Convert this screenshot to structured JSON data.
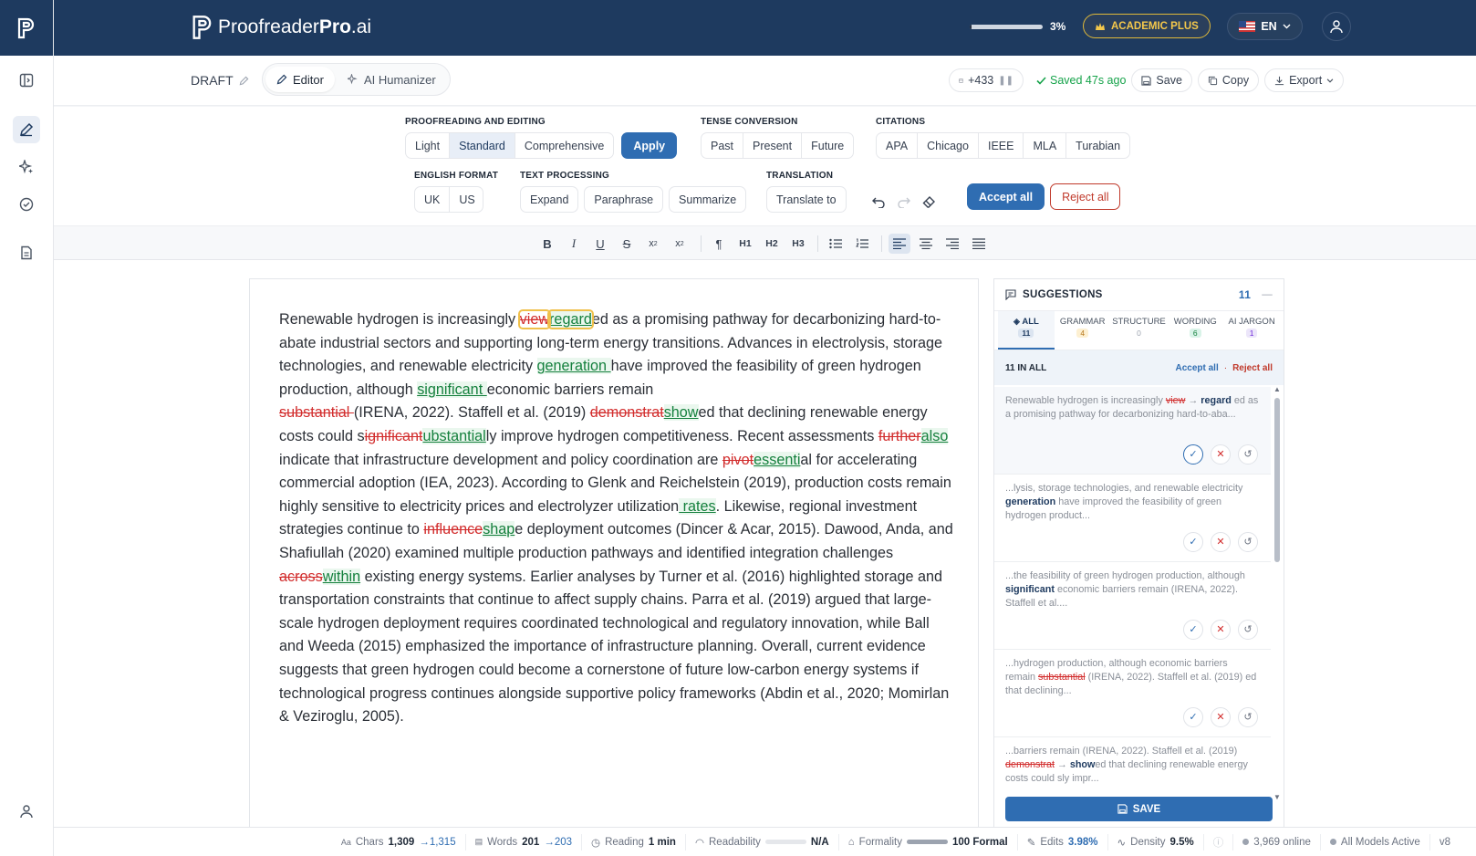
{
  "brand": {
    "name_light": "Proofreader",
    "name_bold": "Pro",
    "name_suffix": ".ai"
  },
  "header": {
    "progress_label": "3%",
    "progress_value": 0.03,
    "plan": "ACADEMIC PLUS",
    "language": "EN"
  },
  "subheader": {
    "draft": "DRAFT",
    "tabs": [
      {
        "label": "Editor"
      },
      {
        "label": "AI Humanizer"
      }
    ],
    "counter": "+433",
    "saved": "Saved 47s ago",
    "save": "Save",
    "copy": "Copy",
    "export": "Export"
  },
  "tools": {
    "proofreading": {
      "label": "PROOFREADING AND EDITING",
      "options": [
        "Light",
        "Standard",
        "Comprehensive"
      ],
      "selected": "Standard",
      "apply": "Apply"
    },
    "tense": {
      "label": "TENSE CONVERSION",
      "options": [
        "Past",
        "Present",
        "Future"
      ]
    },
    "citations": {
      "label": "CITATIONS",
      "options": [
        "APA",
        "Chicago",
        "IEEE",
        "MLA",
        "Turabian"
      ]
    },
    "english": {
      "label": "ENGLISH FORMAT",
      "options": [
        "UK",
        "US"
      ]
    },
    "text_processing": {
      "label": "TEXT PROCESSING",
      "options": [
        "Expand",
        "Paraphrase",
        "Summarize"
      ]
    },
    "translation": {
      "label": "TRANSLATION",
      "button": "Translate to"
    },
    "accept_all": "Accept all",
    "reject_all": "Reject all"
  },
  "format": {
    "h1": "H1",
    "h2": "H2",
    "h3": "H3"
  },
  "document": {
    "t01": "Renewable hydrogen is increasingly ",
    "d01": "view",
    "i01": "regard",
    "t02": "ed as a promising pathway for decarbonizing hard-to-abate industrial sectors and supporting long-term energy transitions. Advances in electrolysis, storage technologies, and renewable electricity ",
    "i02": "generation ",
    "t03": "have improved the feasibility of green hydrogen production, although ",
    "i03": "significant ",
    "t04": "economic barriers remain ",
    "d04": "substantial ",
    "t05": "(IRENA, 2022). Staffell et al. (2019) ",
    "d05": "demonstrat",
    "i05": "show",
    "t06": "ed that declining renewable energy costs could s",
    "d06": "ignificant",
    "i06": "ubstantial",
    "t07": "ly improve hydrogen competitiveness. Recent assessments ",
    "d07": "further",
    "i07": "also",
    "t08": " indicate that infrastructure development and policy coordination are ",
    "d08": "pivot",
    "i08": "essenti",
    "t09": "al for accelerating commercial adoption (IEA, 2023). According to Glenk and Reichelstein (2019), production costs remain highly sensitive to electricity prices and electrolyzer utilization",
    "i09": " rates",
    "t10": ". Likewise, regional investment strategies continue to ",
    "d10": "influence",
    "i10": "shap",
    "t11": "e deployment outcomes (Dincer & Acar, 2015). Dawood, Anda, and Shafiullah (2020) examined multiple production pathways and identified integration challenges ",
    "d11": "across",
    "i11": "within",
    "t12": " existing energy systems. Earlier analyses by Turner et al. (2016) highlighted storage and transportation constraints that continue to affect supply chains. Parra et al. (2019) argued that large-scale hydrogen deployment requires coordinated technological and regulatory innovation, while Ball and Weeda (2015) emphasized the importance of infrastructure planning. Overall, current evidence suggests that green hydrogen could become a cornerstone of future low-carbon energy systems if technological progress continues alongside supportive policy frameworks (Abdin et al., 2020; Momirlan & Veziroglu, 2005)."
  },
  "panel": {
    "title": "SUGGESTIONS",
    "count": "11",
    "tabs": [
      {
        "label": "ALL",
        "n": "11"
      },
      {
        "label": "GRAMMAR",
        "n": "4"
      },
      {
        "label": "STRUCTURE",
        "n": "0"
      },
      {
        "label": "WORDING",
        "n": "6"
      },
      {
        "label": "AI JARGON",
        "n": "1"
      }
    ],
    "summary": "11 IN ALL",
    "accept_all": "Accept all",
    "reject_all": "Reject all",
    "items": [
      {
        "pre": "Renewable hydrogen is increasingly ",
        "del": "view",
        "arrow": "→",
        "ins": "regard",
        "post": "ed as a promising pathway for decarbonizing hard-to-aba..."
      },
      {
        "pre": "...lysis, storage technologies, and renewable electricity ",
        "ins": "generation",
        "post": " have improved the feasibility of green hydrogen product..."
      },
      {
        "pre": "...the feasibility of green hydrogen production, although ",
        "ins": "significant",
        "post": " economic barriers remain (IRENA, 2022). Staffell et al...."
      },
      {
        "pre": "...hydrogen production, although economic barriers remain ",
        "del": "substantial",
        "post": " (IRENA, 2022). Staffell et al. (2019) ed that declining..."
      },
      {
        "pre": "...barriers remain (IRENA, 2022). Staffell et al. (2019) ",
        "del": "demonstrat",
        "arrow": "→",
        "ins": "show",
        "post": "ed that declining renewable energy costs could sly impr..."
      }
    ],
    "save": "SAVE"
  },
  "status": {
    "chars_label": "Chars",
    "chars_from": "1,309",
    "chars_to": "→1,315",
    "words_label": "Words",
    "words_from": "201",
    "words_to": "→203",
    "reading_label": "Reading",
    "reading_value": "1 min",
    "readability_label": "Readability",
    "readability_value": "N/A",
    "formality_label": "Formality",
    "formality_value": "100 Formal",
    "formality_level": 1.0,
    "edits_label": "Edits",
    "edits_value": "3.98%",
    "density_label": "Density",
    "density_value": "9.5%",
    "online": "3,969 online",
    "models": "All Models Active",
    "version": "v8"
  },
  "colors": {
    "navy": "#1e3a5f",
    "accent": "#2f6db2",
    "gold": "#f5c84b",
    "insert": "#15803d",
    "delete": "#d22d2d"
  }
}
